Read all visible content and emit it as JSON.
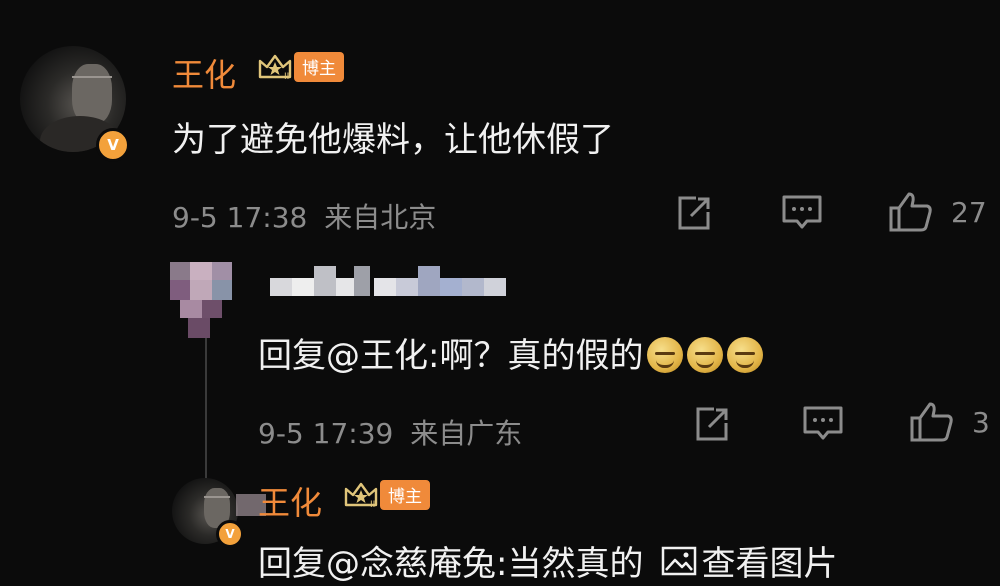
{
  "comments": [
    {
      "author": "王化",
      "badge": "博主",
      "verified_mark": "V",
      "text": "为了避免他爆料，让他休假了",
      "time": "9-5 17:38",
      "location": "来自北京",
      "likes": "27"
    }
  ],
  "replies": [
    {
      "text_prefix": "回复@王化:啊？真的假的",
      "time": "9-5 17:39",
      "location": "来自广东",
      "likes": "3",
      "emoji_count": 3
    },
    {
      "author": "王化",
      "badge": "博主",
      "verified_mark": "V",
      "text": "回复@念慈庵兔:当然真的",
      "view_image_label": "查看图片"
    }
  ],
  "colors": {
    "background": "#0b0b0b",
    "author_name": "#f08a3a",
    "badge_bg": "#f08a3a",
    "verified_badge": "#f3a13b",
    "meta_text": "#8c8c8c"
  },
  "icons": [
    "share-icon",
    "comment-icon",
    "like-icon",
    "image-icon",
    "crown-icon"
  ]
}
